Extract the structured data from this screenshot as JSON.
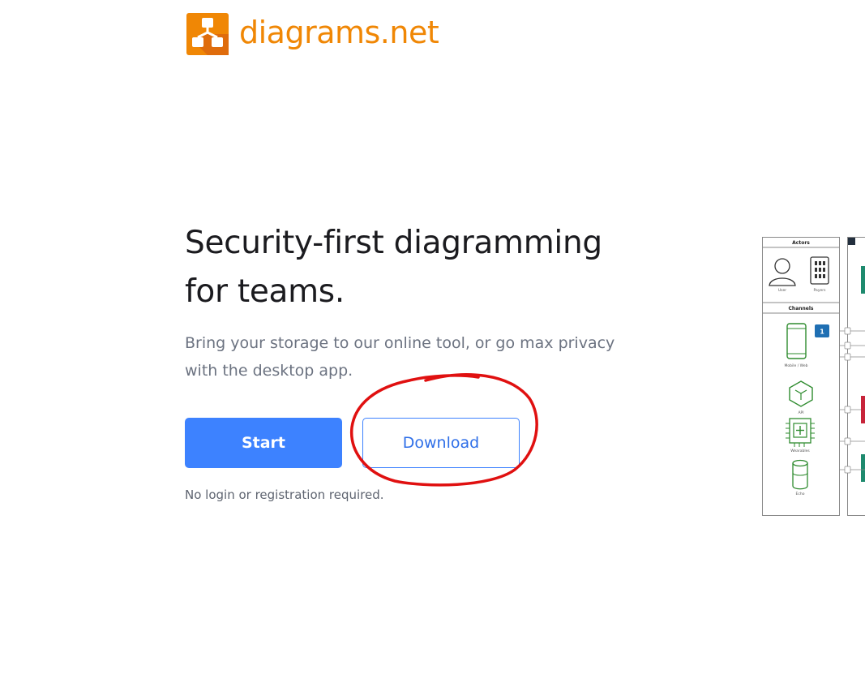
{
  "brand": {
    "name": "diagrams.net",
    "logo_icon": "diagrams-logo-icon",
    "color": "#f08705"
  },
  "hero": {
    "headline_line1": "Security-first diagramming",
    "headline_line2": "for teams.",
    "subheadline_line1": "Bring your storage to our online tool, or go max privacy",
    "subheadline_line2": "with the desktop app.",
    "start_label": "Start",
    "download_label": "Download",
    "note": "No login or registration required."
  },
  "colors": {
    "primary": "#3d82ff",
    "annotation": "#e01010",
    "heading": "#1b1b1f",
    "muted": "#6b7280"
  },
  "preview": {
    "actors_title": "Actors",
    "user_label": "User",
    "payers_label": "Payers",
    "channels_title": "Channels",
    "mobile_label": "Mobile / Web",
    "badge": "1",
    "api_label": "API",
    "wearables_label": "Wearables",
    "echo_label": "Echo"
  }
}
